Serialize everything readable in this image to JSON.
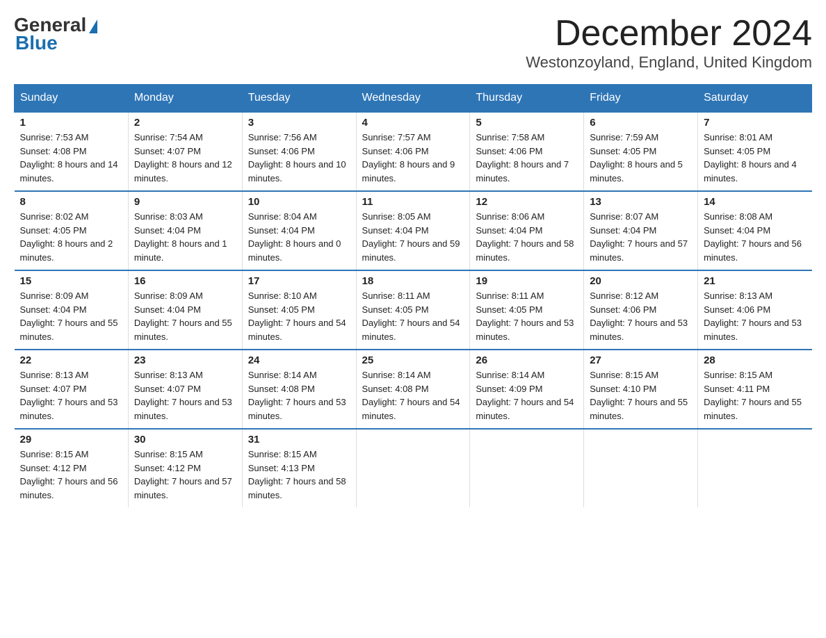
{
  "header": {
    "logo_general": "General",
    "logo_blue": "Blue",
    "month_title": "December 2024",
    "location": "Westonzoyland, England, United Kingdom"
  },
  "days_of_week": [
    "Sunday",
    "Monday",
    "Tuesday",
    "Wednesday",
    "Thursday",
    "Friday",
    "Saturday"
  ],
  "weeks": [
    [
      {
        "day": "1",
        "sunrise": "7:53 AM",
        "sunset": "4:08 PM",
        "daylight": "8 hours and 14 minutes."
      },
      {
        "day": "2",
        "sunrise": "7:54 AM",
        "sunset": "4:07 PM",
        "daylight": "8 hours and 12 minutes."
      },
      {
        "day": "3",
        "sunrise": "7:56 AM",
        "sunset": "4:06 PM",
        "daylight": "8 hours and 10 minutes."
      },
      {
        "day": "4",
        "sunrise": "7:57 AM",
        "sunset": "4:06 PM",
        "daylight": "8 hours and 9 minutes."
      },
      {
        "day": "5",
        "sunrise": "7:58 AM",
        "sunset": "4:06 PM",
        "daylight": "8 hours and 7 minutes."
      },
      {
        "day": "6",
        "sunrise": "7:59 AM",
        "sunset": "4:05 PM",
        "daylight": "8 hours and 5 minutes."
      },
      {
        "day": "7",
        "sunrise": "8:01 AM",
        "sunset": "4:05 PM",
        "daylight": "8 hours and 4 minutes."
      }
    ],
    [
      {
        "day": "8",
        "sunrise": "8:02 AM",
        "sunset": "4:05 PM",
        "daylight": "8 hours and 2 minutes."
      },
      {
        "day": "9",
        "sunrise": "8:03 AM",
        "sunset": "4:04 PM",
        "daylight": "8 hours and 1 minute."
      },
      {
        "day": "10",
        "sunrise": "8:04 AM",
        "sunset": "4:04 PM",
        "daylight": "8 hours and 0 minutes."
      },
      {
        "day": "11",
        "sunrise": "8:05 AM",
        "sunset": "4:04 PM",
        "daylight": "7 hours and 59 minutes."
      },
      {
        "day": "12",
        "sunrise": "8:06 AM",
        "sunset": "4:04 PM",
        "daylight": "7 hours and 58 minutes."
      },
      {
        "day": "13",
        "sunrise": "8:07 AM",
        "sunset": "4:04 PM",
        "daylight": "7 hours and 57 minutes."
      },
      {
        "day": "14",
        "sunrise": "8:08 AM",
        "sunset": "4:04 PM",
        "daylight": "7 hours and 56 minutes."
      }
    ],
    [
      {
        "day": "15",
        "sunrise": "8:09 AM",
        "sunset": "4:04 PM",
        "daylight": "7 hours and 55 minutes."
      },
      {
        "day": "16",
        "sunrise": "8:09 AM",
        "sunset": "4:04 PM",
        "daylight": "7 hours and 55 minutes."
      },
      {
        "day": "17",
        "sunrise": "8:10 AM",
        "sunset": "4:05 PM",
        "daylight": "7 hours and 54 minutes."
      },
      {
        "day": "18",
        "sunrise": "8:11 AM",
        "sunset": "4:05 PM",
        "daylight": "7 hours and 54 minutes."
      },
      {
        "day": "19",
        "sunrise": "8:11 AM",
        "sunset": "4:05 PM",
        "daylight": "7 hours and 53 minutes."
      },
      {
        "day": "20",
        "sunrise": "8:12 AM",
        "sunset": "4:06 PM",
        "daylight": "7 hours and 53 minutes."
      },
      {
        "day": "21",
        "sunrise": "8:13 AM",
        "sunset": "4:06 PM",
        "daylight": "7 hours and 53 minutes."
      }
    ],
    [
      {
        "day": "22",
        "sunrise": "8:13 AM",
        "sunset": "4:07 PM",
        "daylight": "7 hours and 53 minutes."
      },
      {
        "day": "23",
        "sunrise": "8:13 AM",
        "sunset": "4:07 PM",
        "daylight": "7 hours and 53 minutes."
      },
      {
        "day": "24",
        "sunrise": "8:14 AM",
        "sunset": "4:08 PM",
        "daylight": "7 hours and 53 minutes."
      },
      {
        "day": "25",
        "sunrise": "8:14 AM",
        "sunset": "4:08 PM",
        "daylight": "7 hours and 54 minutes."
      },
      {
        "day": "26",
        "sunrise": "8:14 AM",
        "sunset": "4:09 PM",
        "daylight": "7 hours and 54 minutes."
      },
      {
        "day": "27",
        "sunrise": "8:15 AM",
        "sunset": "4:10 PM",
        "daylight": "7 hours and 55 minutes."
      },
      {
        "day": "28",
        "sunrise": "8:15 AM",
        "sunset": "4:11 PM",
        "daylight": "7 hours and 55 minutes."
      }
    ],
    [
      {
        "day": "29",
        "sunrise": "8:15 AM",
        "sunset": "4:12 PM",
        "daylight": "7 hours and 56 minutes."
      },
      {
        "day": "30",
        "sunrise": "8:15 AM",
        "sunset": "4:12 PM",
        "daylight": "7 hours and 57 minutes."
      },
      {
        "day": "31",
        "sunrise": "8:15 AM",
        "sunset": "4:13 PM",
        "daylight": "7 hours and 58 minutes."
      },
      null,
      null,
      null,
      null
    ]
  ]
}
